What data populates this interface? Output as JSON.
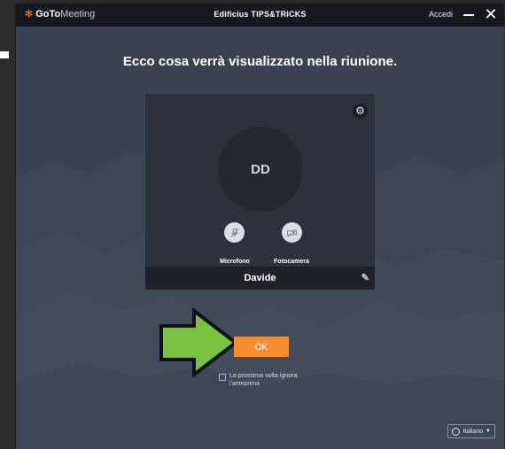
{
  "titlebar": {
    "brand_goto": "GoTo",
    "brand_meeting": "Meeting",
    "title": "Edificius TIPS&TRICKS",
    "accedi": "Accedi",
    "close_glyph": "✕"
  },
  "main": {
    "heading": "Ecco cosa verrà visualizzato nella riunione."
  },
  "preview": {
    "initials": "DD",
    "mic_label": "Microfono",
    "cam_label": "Fotocamera",
    "name": "Davide",
    "settings_icon": "gear-icon",
    "edit_icon": "pencil-icon"
  },
  "actions": {
    "ok_label": "OK",
    "skip_label": "La prossima volta ignora l'anteprima",
    "skip_checked": false
  },
  "language": {
    "selected": "Italiano"
  },
  "colors": {
    "accent": "#f68d2e",
    "arrow": "#7ac142"
  }
}
